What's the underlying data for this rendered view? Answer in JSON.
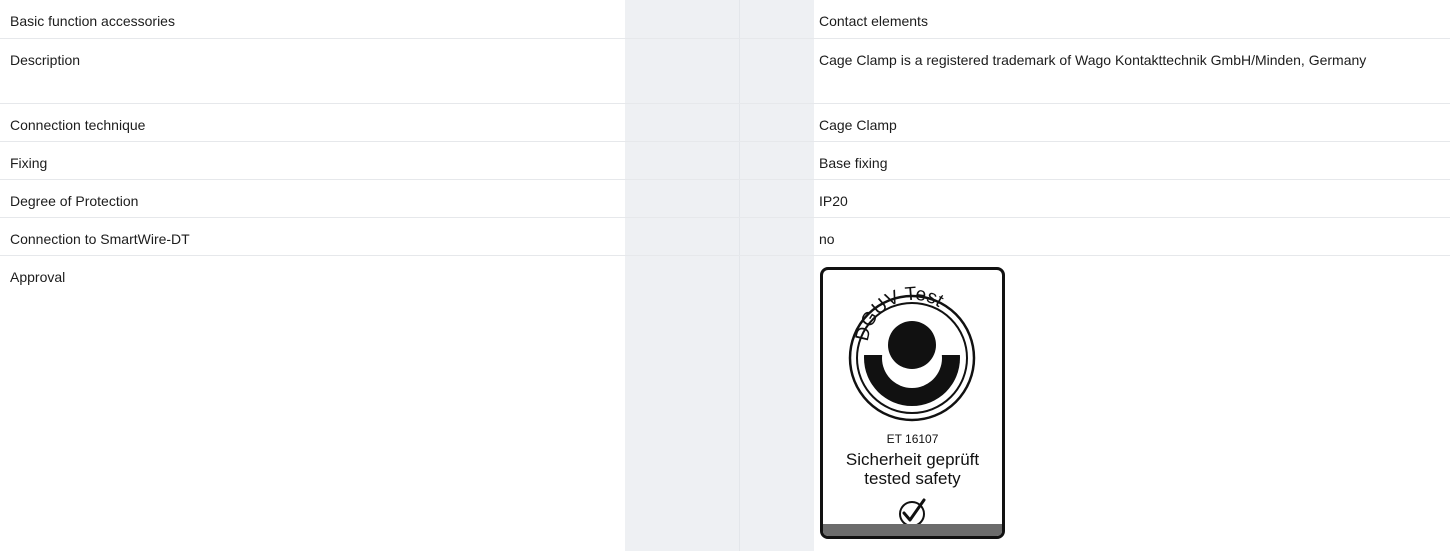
{
  "rows": [
    {
      "label": "Basic function accessories",
      "value": "Contact elements"
    },
    {
      "label": "Description",
      "value": "Cage Clamp is a registered trademark of Wago Kontakttechnik GmbH/Minden, Germany"
    },
    {
      "label": "Connection technique",
      "value": "Cage Clamp"
    },
    {
      "label": "Fixing",
      "value": "Base fixing"
    },
    {
      "label": "Degree of Protection",
      "value": "IP20"
    },
    {
      "label": "Connection to SmartWire-DT",
      "value": "no"
    },
    {
      "label": "Approval",
      "value": ""
    }
  ],
  "badge": {
    "arc_text": "DGUV Test",
    "code": "ET 16107",
    "text_de": "Sicherheit geprüft",
    "text_en": "tested safety",
    "check_icon": "check-circle-icon"
  }
}
